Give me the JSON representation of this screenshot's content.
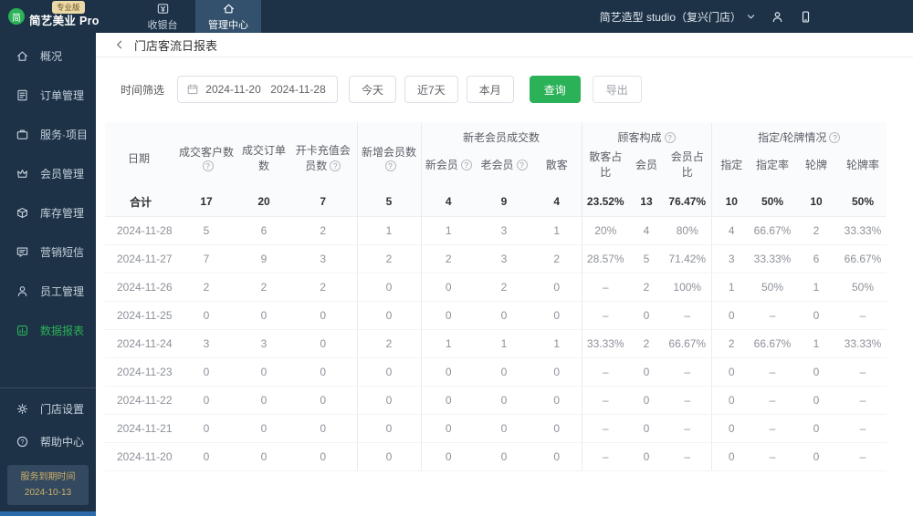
{
  "colors": {
    "navy": "#1d3247",
    "accent_green": "#2bb157",
    "badge_tan": "#ecd9a8",
    "expiry_gold": "#d2b06a",
    "strip_blue": "#2c69a8"
  },
  "brand": {
    "logo_letter": "简",
    "name": "简艺美业 Pro",
    "badge": "专业版"
  },
  "topnav": {
    "items": [
      {
        "key": "cashier",
        "label": "收银台",
        "icon": "cashier-icon",
        "active": false
      },
      {
        "key": "management",
        "label": "管理中心",
        "icon": "management-icon",
        "active": true
      }
    ],
    "store": "简艺造型 studio（复兴门店）"
  },
  "sidebar": {
    "items": [
      {
        "key": "overview",
        "label": "概况",
        "icon": "overview-icon",
        "active": false
      },
      {
        "key": "orders",
        "label": "订单管理",
        "icon": "orders-icon",
        "active": false
      },
      {
        "key": "services",
        "label": "服务·项目",
        "icon": "services-icon",
        "active": false
      },
      {
        "key": "members",
        "label": "会员管理",
        "icon": "members-icon",
        "active": false
      },
      {
        "key": "inventory",
        "label": "库存管理",
        "icon": "inventory-icon",
        "active": false
      },
      {
        "key": "sms",
        "label": "营销短信",
        "icon": "sms-icon",
        "active": false
      },
      {
        "key": "staff",
        "label": "员工管理",
        "icon": "staff-icon",
        "active": false
      },
      {
        "key": "reports",
        "label": "数据报表",
        "icon": "reports-icon",
        "active": true
      }
    ],
    "footer_items": [
      {
        "key": "settings",
        "label": "门店设置",
        "icon": "settings-icon"
      },
      {
        "key": "help",
        "label": "帮助中心",
        "icon": "help-icon"
      }
    ],
    "expiry": {
      "label": "服务到期时间",
      "date": "2024-10-13"
    }
  },
  "page": {
    "title": "门店客流日报表",
    "filter": {
      "label": "时间筛选",
      "date_start": "2024-11-20",
      "date_end": "2024-11-28",
      "quick_buttons": [
        "今天",
        "近7天",
        "本月"
      ],
      "query_label": "查询",
      "export_label": "导出"
    }
  },
  "table": {
    "base_columns": [
      {
        "label": "日期",
        "help": false
      },
      {
        "label": "成交客户数",
        "help": true
      },
      {
        "label": "成交订单数",
        "help": false
      },
      {
        "label": "开卡充值会员数",
        "help": true
      },
      {
        "label": "新增会员数",
        "help": true
      }
    ],
    "groups": [
      {
        "label": "新老会员成交数",
        "help": false,
        "columns": [
          {
            "label": "新会员",
            "help": true
          },
          {
            "label": "老会员",
            "help": true
          },
          {
            "label": "散客",
            "help": false
          }
        ]
      },
      {
        "label": "顾客构成",
        "help": true,
        "columns": [
          {
            "label": "散客占比",
            "help": false
          },
          {
            "label": "会员",
            "help": false
          },
          {
            "label": "会员占比",
            "help": false
          }
        ]
      },
      {
        "label": "指定/轮牌情况",
        "help": true,
        "columns": [
          {
            "label": "指定",
            "help": false
          },
          {
            "label": "指定率",
            "help": false
          },
          {
            "label": "轮牌",
            "help": false
          },
          {
            "label": "轮牌率",
            "help": false
          }
        ]
      }
    ],
    "total_row": [
      "合计",
      "17",
      "20",
      "7",
      "5",
      "4",
      "9",
      "4",
      "23.52%",
      "13",
      "76.47%",
      "10",
      "50%",
      "10",
      "50%"
    ],
    "rows": [
      [
        "2024-11-28",
        "5",
        "6",
        "2",
        "1",
        "1",
        "3",
        "1",
        "20%",
        "4",
        "80%",
        "4",
        "66.67%",
        "2",
        "33.33%"
      ],
      [
        "2024-11-27",
        "7",
        "9",
        "3",
        "2",
        "2",
        "3",
        "2",
        "28.57%",
        "5",
        "71.42%",
        "3",
        "33.33%",
        "6",
        "66.67%"
      ],
      [
        "2024-11-26",
        "2",
        "2",
        "2",
        "0",
        "0",
        "2",
        "0",
        "–",
        "2",
        "100%",
        "1",
        "50%",
        "1",
        "50%"
      ],
      [
        "2024-11-25",
        "0",
        "0",
        "0",
        "0",
        "0",
        "0",
        "0",
        "–",
        "0",
        "–",
        "0",
        "–",
        "0",
        "–"
      ],
      [
        "2024-11-24",
        "3",
        "3",
        "0",
        "2",
        "1",
        "1",
        "1",
        "33.33%",
        "2",
        "66.67%",
        "2",
        "66.67%",
        "1",
        "33.33%"
      ],
      [
        "2024-11-23",
        "0",
        "0",
        "0",
        "0",
        "0",
        "0",
        "0",
        "–",
        "0",
        "–",
        "0",
        "–",
        "0",
        "–"
      ],
      [
        "2024-11-22",
        "0",
        "0",
        "0",
        "0",
        "0",
        "0",
        "0",
        "–",
        "0",
        "–",
        "0",
        "–",
        "0",
        "–"
      ],
      [
        "2024-11-21",
        "0",
        "0",
        "0",
        "0",
        "0",
        "0",
        "0",
        "–",
        "0",
        "–",
        "0",
        "–",
        "0",
        "–"
      ],
      [
        "2024-11-20",
        "0",
        "0",
        "0",
        "0",
        "0",
        "0",
        "0",
        "–",
        "0",
        "–",
        "0",
        "–",
        "0",
        "–"
      ]
    ],
    "icons": {
      "cashier-icon": "cash register (¥ box)",
      "management-icon": "house",
      "overview-icon": "house",
      "orders-icon": "document with lines",
      "services-icon": "briefcase",
      "members-icon": "crown",
      "inventory-icon": "cube",
      "sms-icon": "chat bubble",
      "staff-icon": "person",
      "reports-icon": "bar chart in square",
      "settings-icon": "gear",
      "help-icon": "question mark circle",
      "calendar-icon": "calendar",
      "person-icon": "person",
      "phone-icon": "mobile phone",
      "chevron-down-icon": "chevron down",
      "back-icon": "chevron left",
      "help-badge": "?"
    }
  }
}
